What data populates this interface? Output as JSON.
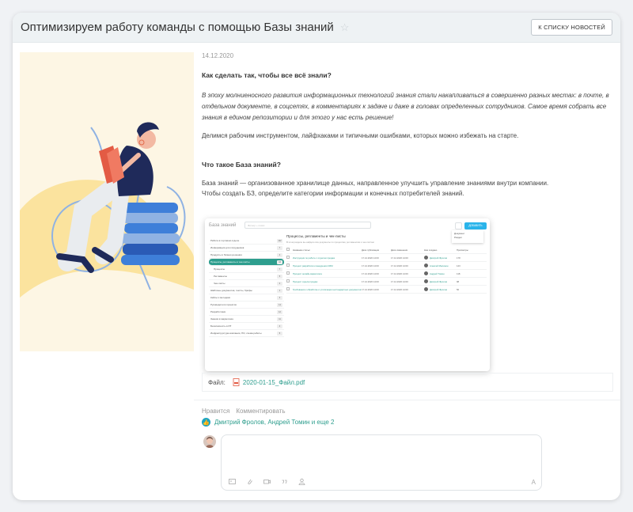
{
  "header": {
    "title": "Оптимизируем работу команды с помощью Базы знаний",
    "back_label": "К СПИСКУ НОВОСТЕЙ"
  },
  "article": {
    "date": "14.12.2020",
    "heading1": "Как сделать так, чтобы все всё знали?",
    "intro": "В эпоху молниеносного развития информационных технологий знания стали накапливаться в совершенно разных местах: в почте, в отдельном документе, в соцсетях, в комментариях к задаче и даже в головах определенных сотрудников. Самое время собрать все знания в едином репозитории и для этого у нас есть решение!",
    "para1": "Делимся рабочим инструментом, лайфхаками и типичными ошибками, которых можно избежать на старте.",
    "heading2": "Что такое База знаний?",
    "para2a": "База знаний — организованное хранилище данных, направленное улучшить управление знаниями внутри компании.",
    "para2b": "Чтобы создать БЗ, определите категории информации и конечных потребителей знаний."
  },
  "file": {
    "label": "Файл:",
    "name": "2020-01-15_Файл.pdf"
  },
  "actions": {
    "like": "Нравится",
    "comment": "Комментировать"
  },
  "likes": {
    "text": "Дмитрий Фролов, Андрей Томин и еще 2"
  },
  "comment_box": {
    "font_label": "A"
  },
  "screenshot": {
    "title": "База знаний",
    "search_placeholder": "Фильтр + поиск",
    "add_button": "ДОБАВИТЬ",
    "dropdown": [
      "Документ",
      "Раздел"
    ],
    "left_items": [
      {
        "label": "Работа в торговом отделе",
        "count": "142",
        "sub": false,
        "active": false
      },
      {
        "label": "Информация для сотрудников",
        "count": "7",
        "sub": false,
        "active": false
      },
      {
        "label": "Продукты и бизнес-решения",
        "count": "4",
        "sub": false,
        "active": false
      },
      {
        "label": "Процессы, регламенты и чек-листы",
        "count": "33",
        "sub": false,
        "active": true
      },
      {
        "label": "Процессы",
        "count": "7",
        "sub": true,
        "active": false
      },
      {
        "label": "Регламенты",
        "count": "5",
        "sub": true,
        "active": false
      },
      {
        "label": "Чек-листы",
        "count": "4",
        "sub": true,
        "active": false
      },
      {
        "label": "Шаблоны документов, тексты, брифы",
        "count": "1",
        "sub": false,
        "active": false
      },
      {
        "label": "Кейсы и методики",
        "count": "3",
        "sub": false,
        "active": false
      },
      {
        "label": "Руководители проектов",
        "count": "14",
        "sub": false,
        "active": false
      },
      {
        "label": "Разработчики",
        "count": "12",
        "sub": false,
        "active": false
      },
      {
        "label": "Знания в маркетинге",
        "count": "11",
        "sub": false,
        "active": false
      },
      {
        "label": "Безопасность в ИТ",
        "count": "4",
        "sub": false,
        "active": false
      },
      {
        "label": "Инфраструктура компании, ПО, схема работы",
        "count": "5",
        "sub": false,
        "active": false
      }
    ],
    "main_title": "Процессы, регламенты и чек-листы",
    "main_subtitle": "В этом разделе вы найдете все документы по процессам, регламентам и чек-листам",
    "columns": [
      "Название статьи",
      "Дата публикации",
      "Дата изменения",
      "Кем создано",
      "Просмотры"
    ],
    "rows": [
      {
        "name": "Инструкция по работе с отделом продаж",
        "pub": "17.12.2020 14:00",
        "mod": "17.12.2020 14:00",
        "author": "Дмитрий Фролов",
        "views": "178"
      },
      {
        "name": "Процесс разработки и внедрения CRM",
        "pub": "17.12.2020 14:00",
        "mod": "17.12.2020 14:00",
        "author": "Алексей Малинин",
        "views": "143"
      },
      {
        "name": "Процесс онлайн-маркетинга",
        "pub": "17.12.2020 14:00",
        "mod": "17.12.2020 14:00",
        "author": "Андрей Томин",
        "views": "118"
      },
      {
        "name": "Процесс отдела продаж",
        "pub": "17.12.2020 14:00",
        "mod": "17.12.2020 14:00",
        "author": "Дмитрий Фролов",
        "views": "98"
      },
      {
        "name": "Требования к обработке и утилизации нестандартных документов",
        "pub": "17.12.2020 14:00",
        "mod": "17.12.2020 14:00",
        "author": "Дмитрий Фролов",
        "views": "56"
      }
    ]
  }
}
